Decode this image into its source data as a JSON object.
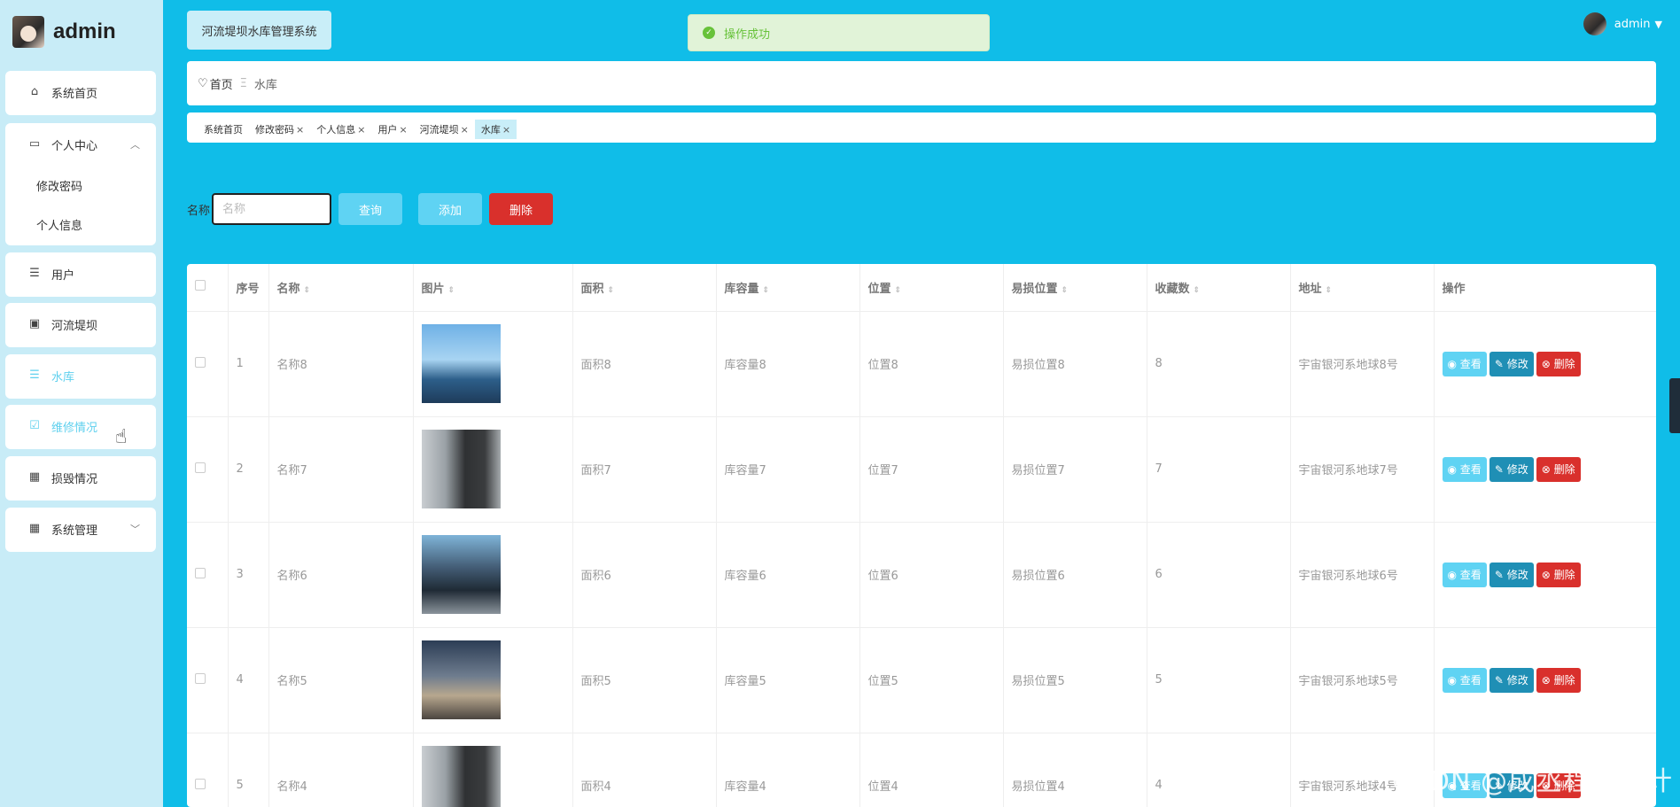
{
  "brand": {
    "name": "admin"
  },
  "app_title": "河流堤坝水库管理系统",
  "toast": {
    "message": "操作成功"
  },
  "user": {
    "name": "admin"
  },
  "breadcrumb": {
    "home": "首页",
    "current": "水库"
  },
  "sidebar": {
    "home": "系统首页",
    "personal_center": "个人中心",
    "change_password": "修改密码",
    "personal_info": "个人信息",
    "users": "用户",
    "river_dam": "河流堤坝",
    "reservoir": "水库",
    "maintenance": "维修情况",
    "damage": "损毁情况",
    "system_mgmt": "系统管理"
  },
  "tags": [
    "系统首页",
    "修改密码",
    "个人信息",
    "用户",
    "河流堤坝",
    "水库"
  ],
  "search": {
    "label": "名称",
    "placeholder": "名称",
    "query_label": "查询",
    "add_label": "添加",
    "delete_label": "删除"
  },
  "table": {
    "columns": [
      "序号",
      "名称",
      "图片",
      "面积",
      "库容量",
      "位置",
      "易损位置",
      "收藏数",
      "地址",
      "操作"
    ],
    "rows": [
      {
        "index": "1",
        "name": "名称8",
        "area": "面积8",
        "capacity": "库容量8",
        "location": "位置8",
        "vulnerable": "易损位置8",
        "favorites": "8",
        "address": "宇宙银河系地球8号"
      },
      {
        "index": "2",
        "name": "名称7",
        "area": "面积7",
        "capacity": "库容量7",
        "location": "位置7",
        "vulnerable": "易损位置7",
        "favorites": "7",
        "address": "宇宙银河系地球7号"
      },
      {
        "index": "3",
        "name": "名称6",
        "area": "面积6",
        "capacity": "库容量6",
        "location": "位置6",
        "vulnerable": "易损位置6",
        "favorites": "6",
        "address": "宇宙银河系地球6号"
      },
      {
        "index": "4",
        "name": "名称5",
        "area": "面积5",
        "capacity": "库容量5",
        "location": "位置5",
        "vulnerable": "易损位置5",
        "favorites": "5",
        "address": "宇宙银河系地球5号"
      },
      {
        "index": "5",
        "name": "名称4",
        "area": "面积4",
        "capacity": "库容量4",
        "location": "位置4",
        "vulnerable": "易损位置4",
        "favorites": "4",
        "address": "宇宙银河系地球4号"
      }
    ],
    "actions": {
      "view": "查看",
      "edit": "修改",
      "delete": "删除"
    }
  },
  "watermark": "CSDN @成丞程序设计",
  "colors": {
    "primary": "#10bde8",
    "sidebar_bg": "#c8ecf7",
    "danger": "#d9302c",
    "edit": "#1f8fb5",
    "light_btn": "#5fd3f3"
  }
}
